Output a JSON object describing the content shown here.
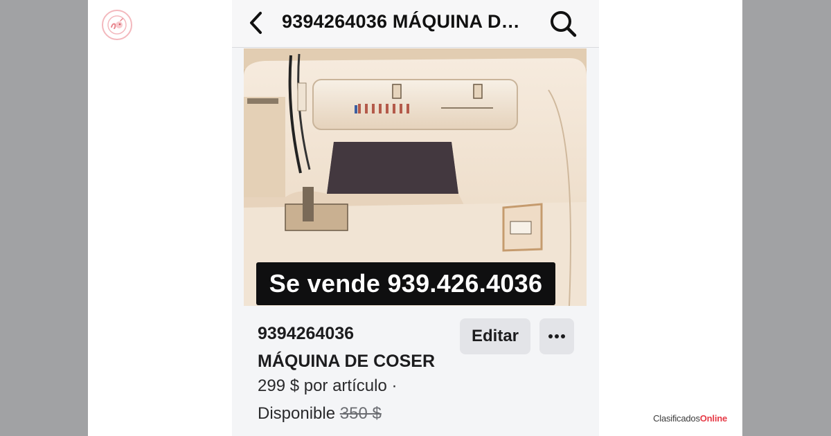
{
  "topbar": {
    "title": "9394264036 MÁQUINA DE COSER",
    "back_icon": "chevron-left-icon",
    "search_icon": "search-icon"
  },
  "photo": {
    "banner_text": "Se vende  939.426.4036"
  },
  "listing": {
    "title_line1": "9394264036",
    "title_line2": "MÁQUINA DE COSER",
    "price_text": "299 $ por artículo ·",
    "availability": "Disponible",
    "original_price": "350 $"
  },
  "actions": {
    "edit_label": "Editar",
    "more_label": "···"
  },
  "watermark": {
    "brand_a": "Clasificados",
    "brand_b": "Online"
  },
  "colors": {
    "accent": "#e63a46",
    "frame_bg": "#a1a2a4",
    "button_bg": "#e3e4e8"
  }
}
